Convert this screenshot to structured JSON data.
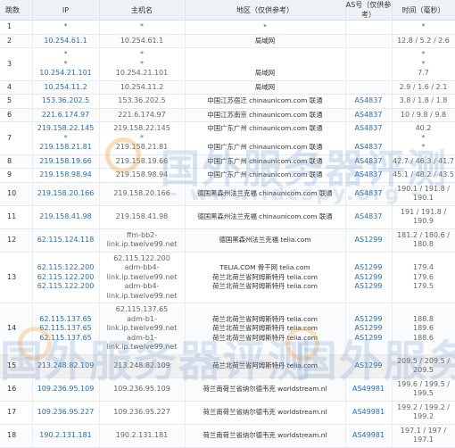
{
  "headers": {
    "hop": "跳数",
    "ip": "IP",
    "hostname": "主机名",
    "geo": "地区（仅供参考）",
    "asn": "AS号（仅供参考）",
    "time": "时间（毫秒）"
  },
  "watermark": {
    "main": "国外服务器评测",
    "url": "- www.idcspy.org -"
  },
  "colors": {
    "link": "#2a6db3",
    "header_bg": "#eef1f5",
    "watermark": "#78a0d2"
  },
  "rows": [
    {
      "hop": "1",
      "ip": [
        "*"
      ],
      "ip_link": false,
      "host": [
        "*"
      ],
      "geo": [
        "*"
      ],
      "asn": [
        ""
      ],
      "time": [
        "*"
      ]
    },
    {
      "hop": "2",
      "ip": [
        "10.254.61.1"
      ],
      "ip_link": true,
      "host": [
        "10.254.61.1"
      ],
      "geo": [
        "局域网"
      ],
      "asn": [
        ""
      ],
      "time": [
        "12.8 / 5.2 / 2.6"
      ]
    },
    {
      "hop": "3",
      "ip": [
        "*",
        "*",
        "10.254.21.101"
      ],
      "ip_link": true,
      "host": [
        "*",
        "*",
        "10.254.21.101"
      ],
      "geo": [
        "",
        "",
        "局域网"
      ],
      "asn": [
        ""
      ],
      "time": [
        "*",
        "*",
        "7.7"
      ]
    },
    {
      "hop": "4",
      "ip": [
        "10.254.11.2"
      ],
      "ip_link": true,
      "host": [
        "10.254.11.2"
      ],
      "geo": [
        "局域网"
      ],
      "asn": [
        ""
      ],
      "time": [
        "2.9 / 1.6 / 2.1"
      ]
    },
    {
      "hop": "5",
      "ip": [
        "153.36.202.5"
      ],
      "ip_link": true,
      "host": [
        "153.36.202.5"
      ],
      "geo": [
        "中国江苏宿迁 chinaunicom.com 联通"
      ],
      "asn": [
        "AS4837"
      ],
      "time": [
        "3.8 / 1.8 / 1.8"
      ]
    },
    {
      "hop": "6",
      "ip": [
        "221.6.174.97"
      ],
      "ip_link": true,
      "host": [
        "221.6.174.97"
      ],
      "geo": [
        "中国江苏南京 chinaunicom.com 联通"
      ],
      "asn": [
        "AS4837"
      ],
      "time": [
        "10 / 9.8 / 9.8"
      ]
    },
    {
      "hop": "7",
      "ip": [
        "219.158.22.145",
        "*",
        "219.158.21.81"
      ],
      "ip_link": true,
      "host": [
        "219.158.22.145",
        "*",
        "219.158.21.81"
      ],
      "geo": [
        "中国广东广州 chinaunicom.com 联通",
        "",
        "中国广东广州 chinaunicom.com 联通"
      ],
      "asn": [
        "AS4837",
        "",
        "AS4837"
      ],
      "time": [
        "40.2",
        "*",
        "*"
      ]
    },
    {
      "hop": "8",
      "ip": [
        "219.158.19.66"
      ],
      "ip_link": true,
      "host": [
        "219.158.19.66"
      ],
      "geo": [
        "中国广东广州 chinaunicom.com 联通"
      ],
      "asn": [
        "AS4837"
      ],
      "time": [
        "42.7 / 46.3 / 41.7"
      ]
    },
    {
      "hop": "9",
      "ip": [
        "219.158.98.94"
      ],
      "ip_link": true,
      "host": [
        "219.158.98.94"
      ],
      "geo": [
        "中国广东广州 chinaunicom.com 联通"
      ],
      "asn": [
        "AS4837"
      ],
      "time": [
        "45.1 / 48.2 / 43.5"
      ]
    },
    {
      "hop": "10",
      "ip": [
        "219.158.20.166"
      ],
      "ip_link": true,
      "host": [
        "219.158.20.166"
      ],
      "geo": [
        "德国黑森州法兰克福 chinaunicom.com 联通"
      ],
      "asn": [
        "AS4837"
      ],
      "time": [
        "190.1 / 191.8 / 190.1"
      ]
    },
    {
      "hop": "11",
      "ip": [
        "219.158.41.98"
      ],
      "ip_link": true,
      "host": [
        "219.158.41.98"
      ],
      "geo": [
        "德国黑森州法兰克福 chinaunicom.com 联通"
      ],
      "asn": [
        "AS4837"
      ],
      "time": [
        "191 / 191.8 / 190.9"
      ]
    },
    {
      "hop": "12",
      "ip": [
        "62.115.124.118"
      ],
      "ip_link": true,
      "host": [
        "ffm-bb2-link.ip.twelve99.net"
      ],
      "geo": [
        "德国黑森州法兰克福 telia.com"
      ],
      "asn": [
        "AS1299"
      ],
      "time": [
        "181.2 / 180.6 / 180.8"
      ]
    },
    {
      "hop": "13",
      "ip": [
        "62.115.122.200",
        "62.115.122.200",
        "62.115.122.200"
      ],
      "ip_link": true,
      "host": [
        "62.115.122.200",
        "adm-bb4-link.ip.twelve99.net",
        "adm-bb4-link.ip.twelve99.net"
      ],
      "geo": [
        "TELIA.COM 骨干网 telia.com",
        "荷兰北荷兰省阿姆斯特丹 telia.com",
        "荷兰北荷兰省阿姆斯特丹 telia.com"
      ],
      "asn": [
        "AS1299",
        "AS1299",
        "AS1299"
      ],
      "time": [
        "179.4",
        "179.6",
        "179.5"
      ]
    },
    {
      "hop": "14",
      "ip": [
        "62.115.137.65",
        "62.115.137.65",
        "62.115.137.65"
      ],
      "ip_link": true,
      "host": [
        "62.115.137.65",
        "adm-b1-link.ip.twelve99.net",
        "adm-b1-link.ip.twelve99.net"
      ],
      "geo": [
        "荷兰北荷兰省阿姆斯特丹 telia.com",
        "荷兰北荷兰省阿姆斯特丹 telia.com",
        "荷兰北荷兰省阿姆斯特丹 telia.com"
      ],
      "asn": [
        "AS1299",
        "AS1299",
        "AS1299"
      ],
      "time": [
        "188.8",
        "189.6",
        "188.6"
      ]
    },
    {
      "hop": "15",
      "ip": [
        "213.248.82.109"
      ],
      "ip_link": true,
      "host": [
        "213.248.82.109"
      ],
      "geo": [
        "荷兰北荷兰省阿姆斯特丹 telia.com"
      ],
      "asn": [
        "AS1299"
      ],
      "time": [
        "209.5 / 209.5 / 209.5"
      ]
    },
    {
      "hop": "16",
      "ip": [
        "109.236.95.109"
      ],
      "ip_link": true,
      "host": [
        "109.236.95.109"
      ],
      "geo": [
        "荷兰南荷兰省纳尔德韦克 worldstream.nl"
      ],
      "asn": [
        "AS49981"
      ],
      "time": [
        "199.6 / 199.5 / 199.5"
      ]
    },
    {
      "hop": "17",
      "ip": [
        "109.236.95.227"
      ],
      "ip_link": true,
      "host": [
        "109.236.95.227"
      ],
      "geo": [
        "荷兰南荷兰省纳尔德韦克 worldstream.nl"
      ],
      "asn": [
        "AS49981"
      ],
      "time": [
        "199.2 / 199.2 / 199.2"
      ]
    },
    {
      "hop": "18",
      "ip": [
        "190.2.131.181"
      ],
      "ip_link": true,
      "host": [
        "190.2.131.181"
      ],
      "geo": [
        "荷兰南荷兰省纳尔德韦克 worldstream.nl"
      ],
      "asn": [
        "AS49981"
      ],
      "time": [
        "197.1 / 197 / 197.1"
      ]
    }
  ]
}
